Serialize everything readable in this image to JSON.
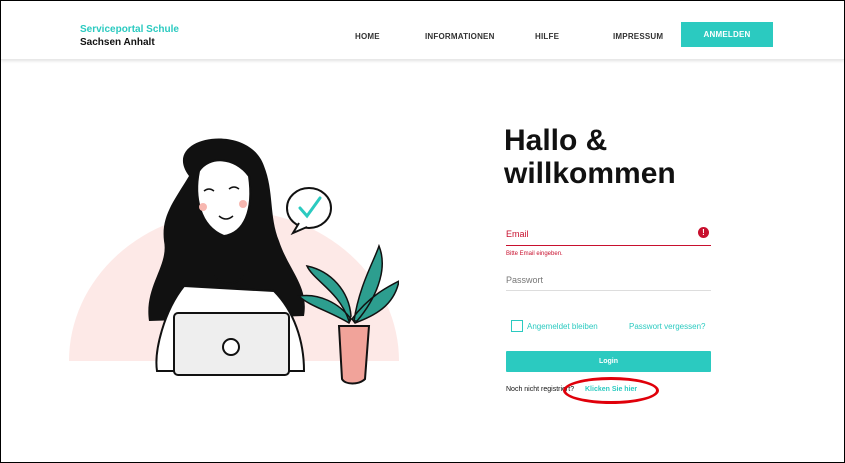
{
  "header": {
    "brand_line1": "Serviceportal Schule",
    "brand_line2": "Sachsen Anhalt",
    "nav": [
      "HOME",
      "INFORMATIONEN",
      "HILFE",
      "IMPRESSUM"
    ],
    "login_label": "ANMELDEN"
  },
  "main": {
    "greeting_line1": "Hallo &",
    "greeting_line2": "willkommen",
    "email_label": "Email",
    "email_error": "Bitte Email eingeben.",
    "error_icon": "!",
    "password_label": "Passwort",
    "remember_label": "Angemeldet bleiben",
    "forgot_link": "Passwort vergessen?",
    "login_button": "Login",
    "register_text": "Noch nicht registriert?",
    "register_link": "Klicken Sie hier"
  },
  "colors": {
    "accent": "#2bcac0",
    "error": "#c8102e",
    "highlight": "#e0000a"
  },
  "icons": {
    "error": "exclamation-circle-icon",
    "checkmark": "checkmark-speech-bubble-icon"
  }
}
